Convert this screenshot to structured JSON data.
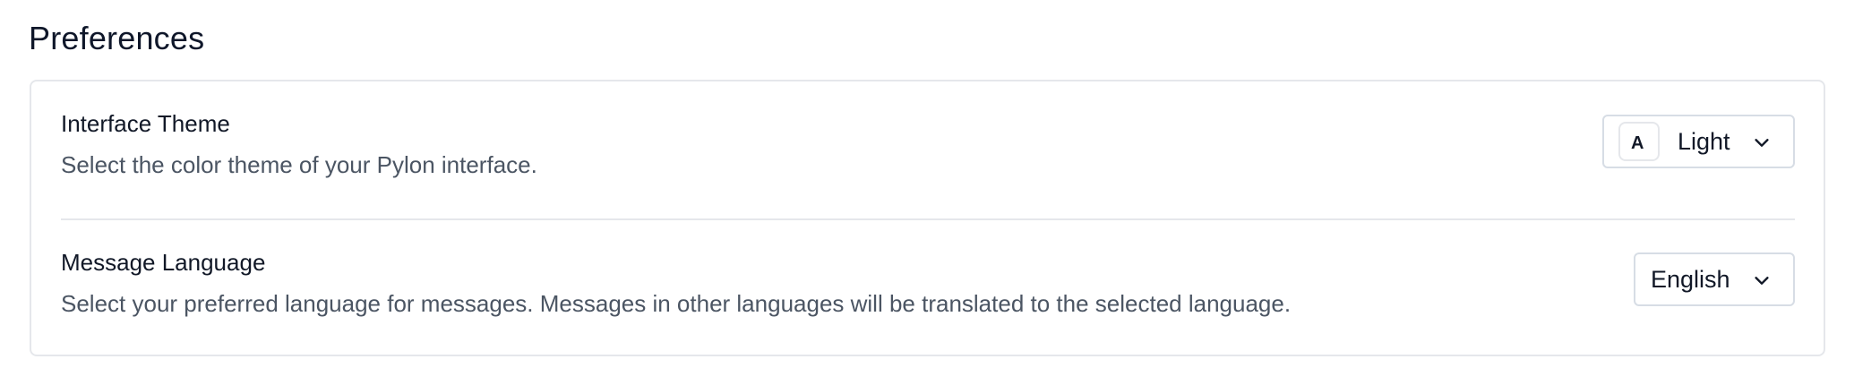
{
  "section": {
    "title": "Preferences"
  },
  "settings": [
    {
      "title": "Interface Theme",
      "description": "Select the color theme of your Pylon interface.",
      "control": {
        "swatch_letter": "A",
        "value": "Light",
        "icon": "chevron-down-icon"
      }
    },
    {
      "title": "Message Language",
      "description": "Select your preferred language for messages. Messages in other languages will be translated to the selected language.",
      "control": {
        "value": "English",
        "icon": "chevron-down-icon"
      }
    }
  ],
  "colors": {
    "title": "#0f172a",
    "description": "#4b5563",
    "border": "#e5e7eb",
    "select_border": "#d7dde5"
  }
}
